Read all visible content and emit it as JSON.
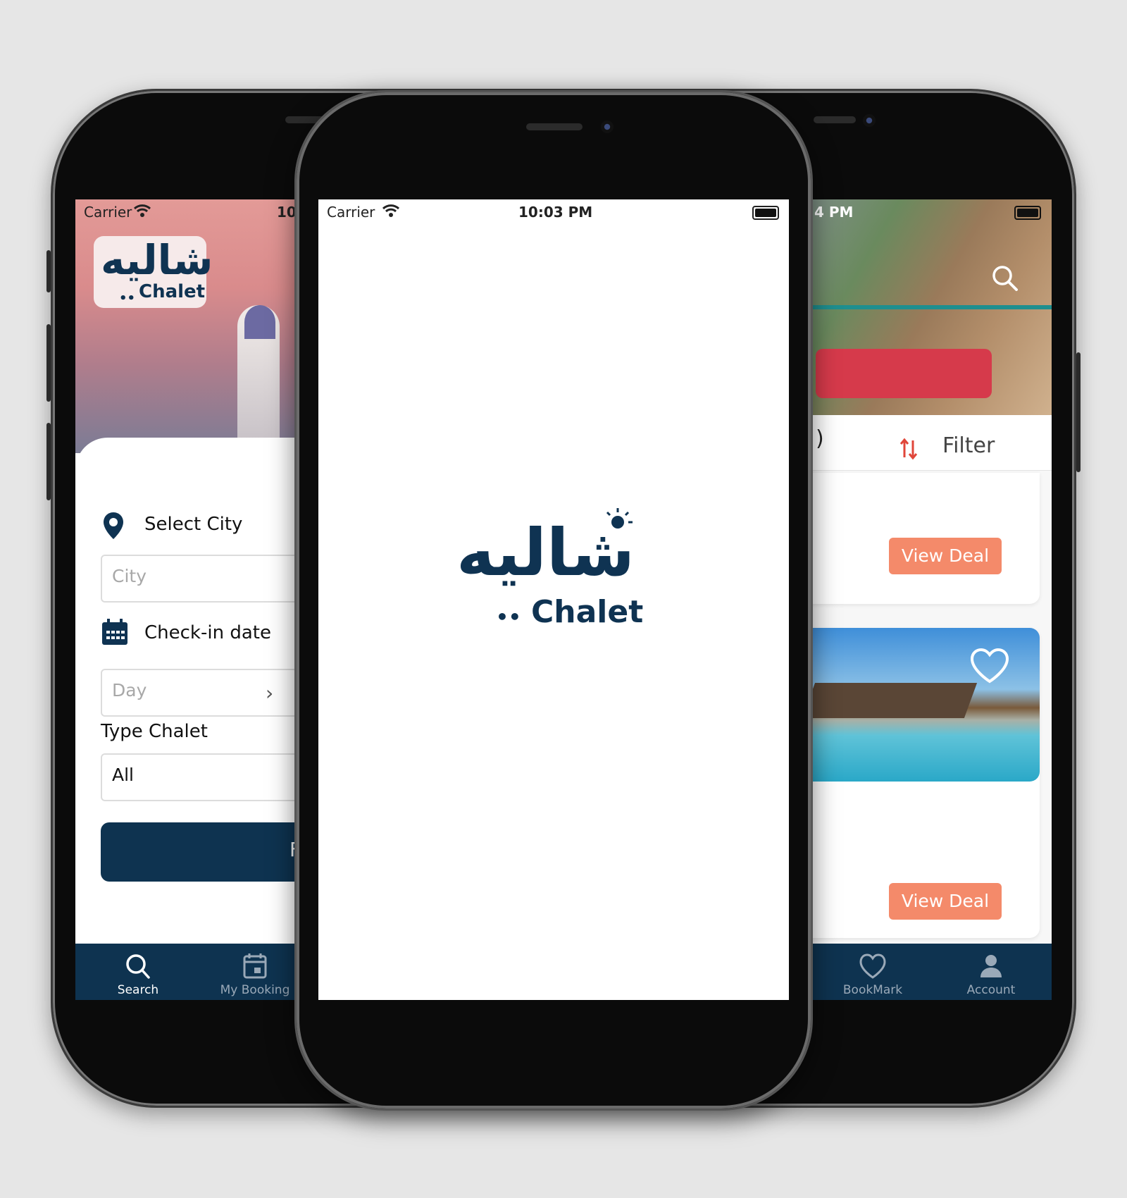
{
  "left_screen": {
    "status": {
      "carrier": "Carrier",
      "time": "10"
    },
    "logo": {
      "arabic": "شاليه",
      "latin": "Chalet",
      "dots": "••"
    },
    "select_city_label": "Select City",
    "city_placeholder": "City",
    "checkin_label": "Check-in date",
    "day_placeholder": "Day",
    "type_label": "Type Chalet",
    "type_value": "All",
    "primary_button_partial": "F",
    "tabs": [
      {
        "label": "Search",
        "icon": "search-icon",
        "active": true
      },
      {
        "label": "My Booking",
        "icon": "calendar-icon",
        "active": false
      }
    ]
  },
  "center_screen": {
    "status": {
      "carrier": "Carrier",
      "time": "10:03 PM"
    },
    "logo": {
      "arabic": "شاليه",
      "latin": "Chalet",
      "dots": "••"
    }
  },
  "right_screen": {
    "status": {
      "time": "4 PM"
    },
    "paren": ")",
    "filter_label": "Filter",
    "cards": [
      {
        "button": "View Deal"
      },
      {
        "button": "View Deal"
      }
    ],
    "tabs": [
      {
        "label": "BookMark",
        "icon": "heart-icon"
      },
      {
        "label": "Account",
        "icon": "person-icon"
      }
    ]
  },
  "colors": {
    "brand": "#0f3352",
    "accent": "#f48a6a",
    "tabbar": "#0e3350"
  }
}
